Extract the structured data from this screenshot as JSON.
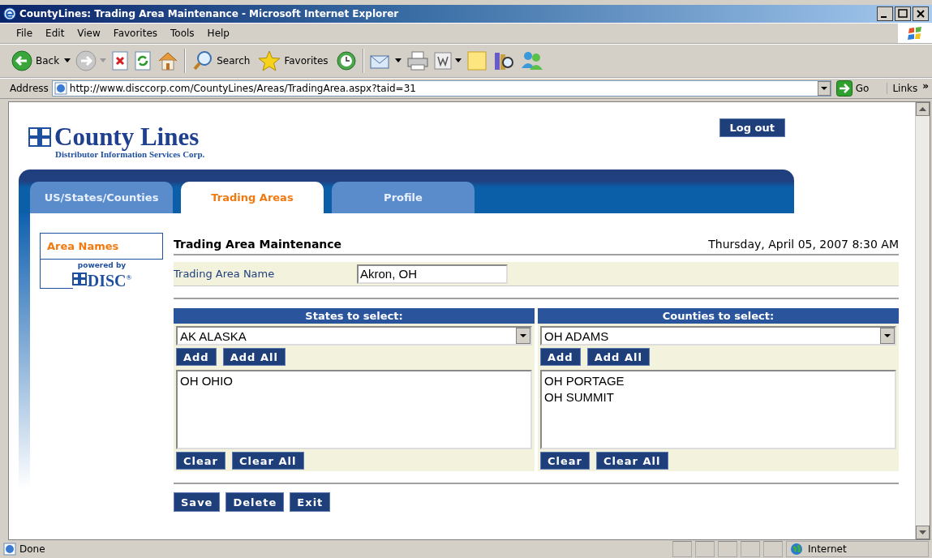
{
  "window": {
    "title": "CountyLines: Trading Area Maintenance - Microsoft Internet Explorer"
  },
  "menu": [
    "File",
    "Edit",
    "View",
    "Favorites",
    "Tools",
    "Help"
  ],
  "toolbar": {
    "back": "Back",
    "search": "Search",
    "favorites": "Favorites"
  },
  "address_bar": {
    "label": "Address",
    "url": "http://www.disccorp.com/CountyLines/Areas/TradingArea.aspx?taid=31",
    "go": "Go",
    "links": "Links",
    "more": "»"
  },
  "page": {
    "logo": {
      "title": "County Lines",
      "subtitle": "Distributor Information Services Corp."
    },
    "logout": "Log out",
    "tabs": [
      {
        "label": "US/States/Counties",
        "selected": false
      },
      {
        "label": "Trading Areas",
        "selected": true
      },
      {
        "label": "Profile",
        "selected": false
      }
    ],
    "sidebar": {
      "items": [
        {
          "label": "Area Names",
          "selected": true
        }
      ],
      "powered_by": "powered by",
      "brand": "DISC$^{®}$"
    },
    "heading": "Trading Area Maintenance",
    "date": "Thursday, April 05, 2007 8:30 AM",
    "name_field": {
      "label": "Trading Area Name",
      "value": "Akron, OH"
    },
    "panels": [
      {
        "title": "States to select:",
        "dropdown": "AK ALASKA",
        "add": "Add",
        "add_all": "Add All",
        "items": [
          "OH OHIO"
        ],
        "clear": "Clear",
        "clear_all": "Clear All"
      },
      {
        "title": "Counties to select:",
        "dropdown": "OH ADAMS",
        "add": "Add",
        "add_all": "Add All",
        "items": [
          "OH PORTAGE",
          "OH SUMMIT"
        ],
        "clear": "Clear",
        "clear_all": "Clear All"
      }
    ],
    "actions": [
      "Save",
      "Delete",
      "Exit"
    ]
  },
  "status_bar": {
    "text": "Done",
    "zone": "Internet"
  }
}
